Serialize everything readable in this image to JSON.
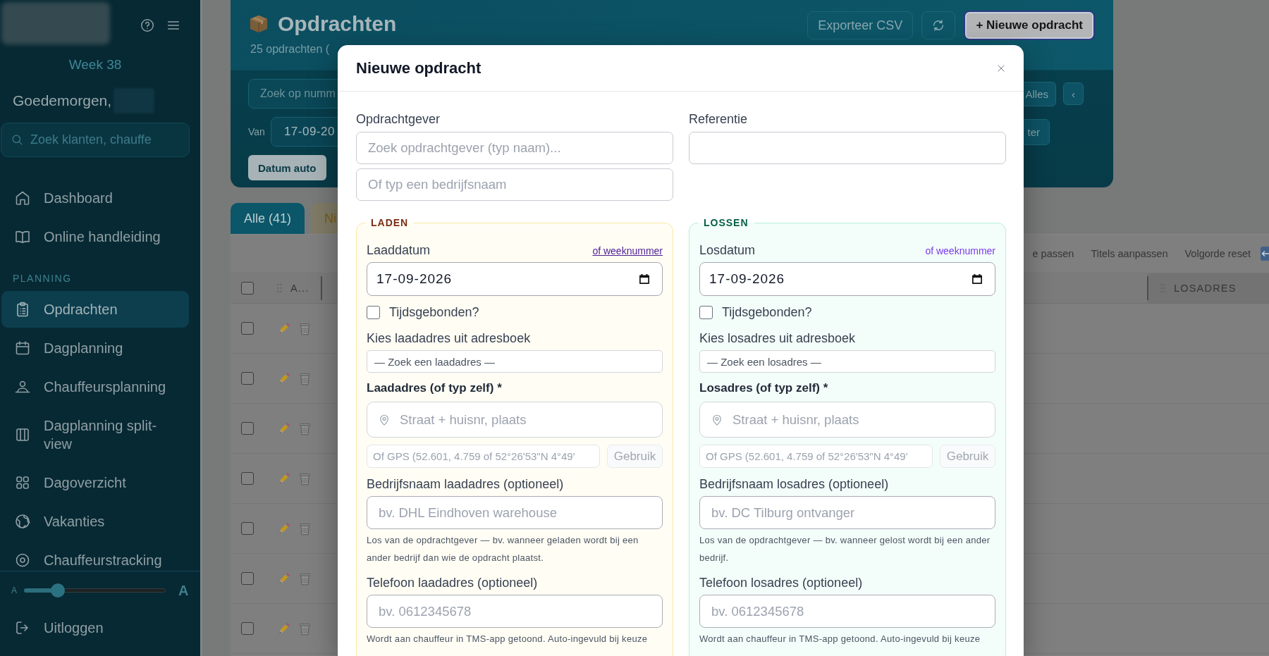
{
  "sidebar": {
    "week": "Week 38",
    "greeting": "Goedemorgen,",
    "search": {
      "placeholder": "Zoek klanten, chauffe"
    },
    "nav": [
      {
        "items": [
          {
            "label": "Dashboard",
            "selected": false
          },
          {
            "label": "Online handleiding",
            "selected": false
          }
        ]
      },
      {
        "heading": "PLANNING",
        "items": [
          {
            "label": "Opdrachten",
            "selected": true
          },
          {
            "label": "Dagplanning",
            "selected": false
          },
          {
            "label": "Chauffeursplanning",
            "selected": false
          },
          {
            "label": "Dagplanning split-view",
            "selected": false
          },
          {
            "label": "Dagoverzicht",
            "selected": false
          },
          {
            "label": "Vakanties",
            "selected": false
          },
          {
            "label": "Chauffeurstracking",
            "selected": false
          }
        ]
      }
    ],
    "font_size": {
      "small_label": "A",
      "large_label": "A",
      "level": 0.24
    },
    "logout": "Uitloggen"
  },
  "header": {
    "title": "Opdrachten",
    "subtitle": "25 opdrachten (",
    "actions": [
      {
        "kind": "secondary",
        "label": "Exporteer CSV",
        "focused": false
      },
      {
        "kind": "icon",
        "focused": false
      },
      {
        "kind": "primary",
        "label": "+ Nieuwe opdracht",
        "focused": true
      }
    ],
    "filters": {
      "search": {
        "placeholder": "Zoek op numm"
      },
      "range_buttons": [
        "Alles",
        "‹"
      ],
      "date_from": {
        "label": "Van",
        "value": "17-09-20"
      },
      "apply_button": "ter",
      "auto_date_button": "Datum auto"
    }
  },
  "tabs": [
    {
      "label": "Alle (41)",
      "selected": true,
      "color": "#0b5669"
    },
    {
      "label": "Ni",
      "selected": false,
      "color": "#7f7b66"
    }
  ],
  "table": {
    "toolbar": [
      "e passen",
      "Titels aanpassen",
      "Volgorde reset"
    ],
    "columns": [
      {
        "label": "A..."
      },
      {
        "label": "LOSADRES"
      }
    ],
    "select_all": {
      "checked": false
    },
    "rows": [
      {
        "checked": false
      },
      {
        "checked": false
      },
      {
        "checked": false
      },
      {
        "checked": false
      },
      {
        "checked": false
      },
      {
        "checked": false
      },
      {
        "checked": false
      }
    ]
  },
  "modal": {
    "title": "Nieuwe opdracht",
    "client": {
      "label": "Opdrachtgever",
      "search_placeholder": "Zoek opdrachtgever (typ naam)...",
      "name_placeholder": "Of typ een bedrijfsnaam"
    },
    "reference": {
      "label": "Referentie"
    },
    "stops": [
      {
        "kind": "load",
        "legend": "LADEN",
        "date": {
          "label": "Laaddatum",
          "value": "17-09-2026",
          "week_link": {
            "label": "of weeknummer",
            "hovered": true
          }
        },
        "time_bound": {
          "label": "Tijdsgebonden?",
          "checked": false
        },
        "address_book": {
          "label": "Kies laadadres uit adresboek",
          "placeholder": "— Zoek een laadadres —"
        },
        "address": {
          "label": "Laadadres (of typ zelf) *",
          "placeholder": "Straat + huisnr, plaats"
        },
        "gps": {
          "placeholder": "Of GPS (52.601, 4.759 of 52°26'53\"N 4°49'",
          "button": {
            "label": "Gebruik",
            "disabled": true
          }
        },
        "company": {
          "label": "Bedrijfsnaam laadadres (optioneel)",
          "placeholder": "bv. DHL Eindhoven warehouse",
          "help": "Los van de opdrachtgever — bv. wanneer geladen wordt bij een ander bedrijf dan wie de opdracht plaatst."
        },
        "phone": {
          "label": "Telefoon laadadres (optioneel)",
          "placeholder": "bv. 0612345678",
          "help": "Wordt aan chauffeur in TMS-app getoond. Auto-ingevuld bij keuze"
        }
      },
      {
        "kind": "unload",
        "legend": "LOSSEN",
        "date": {
          "label": "Losdatum",
          "value": "17-09-2026",
          "week_link": {
            "label": "of weeknummer",
            "hovered": false
          }
        },
        "time_bound": {
          "label": "Tijdsgebonden?",
          "checked": false
        },
        "address_book": {
          "label": "Kies losadres uit adresboek",
          "placeholder": "— Zoek een losadres —"
        },
        "address": {
          "label": "Losadres (of typ zelf) *",
          "placeholder": "Straat + huisnr, plaats"
        },
        "gps": {
          "placeholder": "Of GPS (52.601, 4.759 of 52°26'53\"N 4°49'",
          "button": {
            "label": "Gebruik",
            "disabled": true
          }
        },
        "company": {
          "label": "Bedrijfsnaam losadres (optioneel)",
          "placeholder": "bv. DC Tilburg ontvanger",
          "help": "Los van de opdrachtgever — bv. wanneer gelost wordt bij een ander bedrijf."
        },
        "phone": {
          "label": "Telefoon losadres (optioneel)",
          "placeholder": "bv. 0612345678",
          "help": "Wordt aan chauffeur in TMS-app getoond. Auto-ingevuld bij keuze"
        }
      }
    ]
  }
}
